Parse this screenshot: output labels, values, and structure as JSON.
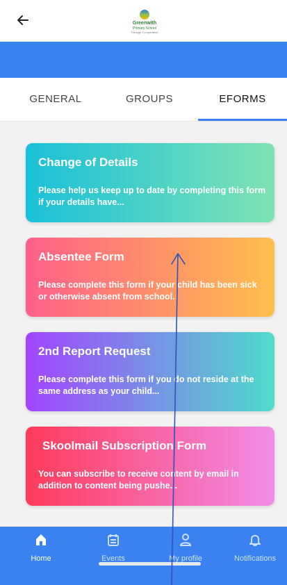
{
  "header": {
    "back_icon": "arrow-left-icon",
    "logo": {
      "name": "Greenwith",
      "subtitle": "Primary School",
      "tagline": "Through Co-operation"
    }
  },
  "tabs": [
    {
      "label": "GENERAL",
      "active": false
    },
    {
      "label": "GROUPS",
      "active": false
    },
    {
      "label": "EFORMS",
      "active": true
    }
  ],
  "forms": [
    {
      "title": "Change of Details",
      "description": "Please help us keep up to date by completing this form if your details have..."
    },
    {
      "title": "Absentee Form",
      "description": "Please complete this form if your child has been sick or otherwise absent from school."
    },
    {
      "title": "2nd Report Request",
      "description": "Please complete this form if you do not reside at the same address as your child..."
    },
    {
      "title": "Skoolmail Subscription Form",
      "description": "You can subscribe to receive content by email in addition to content being pushe..."
    }
  ],
  "bottom_nav": [
    {
      "label": "Home",
      "icon": "home-icon",
      "active": true
    },
    {
      "label": "Events",
      "icon": "calendar-icon",
      "active": false
    },
    {
      "label": "My profile",
      "icon": "user-icon",
      "active": false
    },
    {
      "label": "Notifications",
      "icon": "bell-icon",
      "active": false
    }
  ],
  "colors": {
    "accent": "#3b82f1"
  }
}
